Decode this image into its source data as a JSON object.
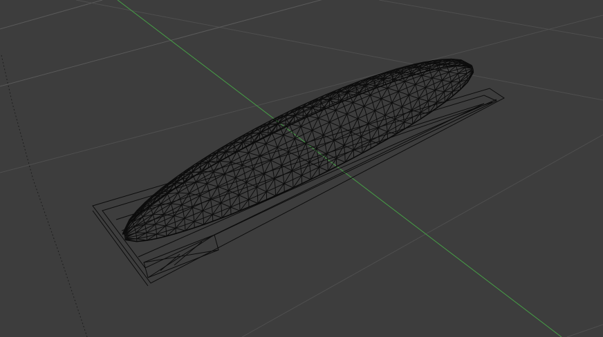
{
  "viewport": {
    "background_color": "#3d3d3d",
    "grid_color": "#4f4f4f",
    "y_axis_color": "#46a046",
    "wire_color": "#0c0c0c",
    "display_mode": "wireframe"
  }
}
